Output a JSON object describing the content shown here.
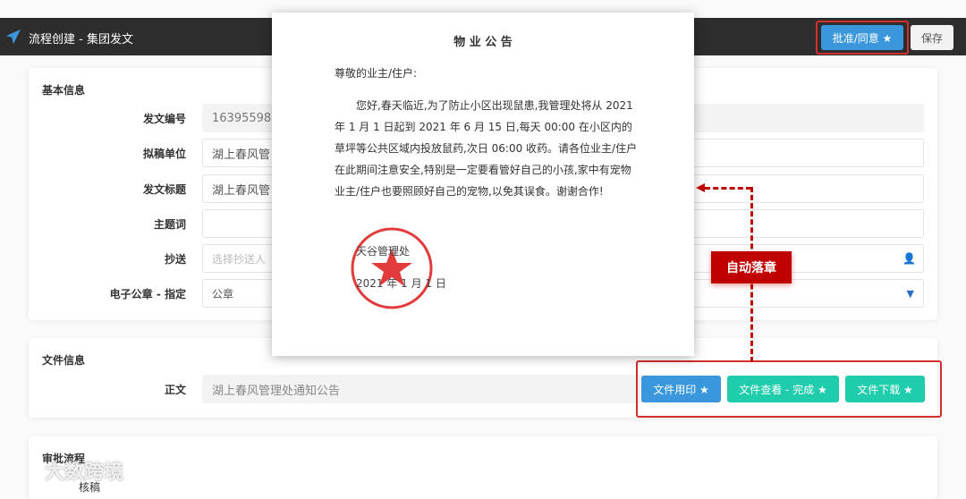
{
  "header": {
    "title": "流程创建 - 集团发文",
    "approve_label": "批准/同意 ★",
    "save_label": "保存"
  },
  "basic": {
    "section": "基本信息",
    "fields": [
      {
        "label": "发文编号",
        "value": "1639559855"
      },
      {
        "label": "拟稿单位",
        "value": "湖上春风管"
      },
      {
        "label": "发文标题",
        "value": "湖上春风管"
      },
      {
        "label": "主题词",
        "value": ""
      },
      {
        "label": "抄送",
        "placeholder": "选择抄送人"
      },
      {
        "label": "电子公章 - 指定",
        "value": "公章"
      }
    ]
  },
  "file": {
    "section": "文件信息",
    "label": "正文",
    "value": "湖上春风管理处通知公告",
    "buttons": [
      "文件用印 ★",
      "文件查看 - 完成 ★",
      "文件下载 ★"
    ]
  },
  "approval": {
    "section": "审批流程",
    "step": "核稿"
  },
  "notice": {
    "title": "物 业 公 告",
    "greeting": "尊敬的业主/住户:",
    "body": "您好,春天临近,为了防止小区出现鼠患,我管理处将从 2021 年 1 月 1 日起到 2021 年 6 月 15 日,每天 00:00 在小区内的草坪等公共区域内投放鼠药,次日 06:00 收药。请各位业主/住户在此期间注意安全,特别是一定要看管好自己的小孩,家中有宠物业主/住户也要照顾好自己的宠物,以免其误食。谢谢合作!",
    "signer": "天谷管理处",
    "date": "2021 年 1 月 1 日"
  },
  "annotation": {
    "label": "自动落章"
  },
  "watermark": {
    "text": "大数跨境"
  },
  "colors": {
    "blue": "#3a97dc",
    "teal": "#1fcdac",
    "red": "#c00000"
  }
}
